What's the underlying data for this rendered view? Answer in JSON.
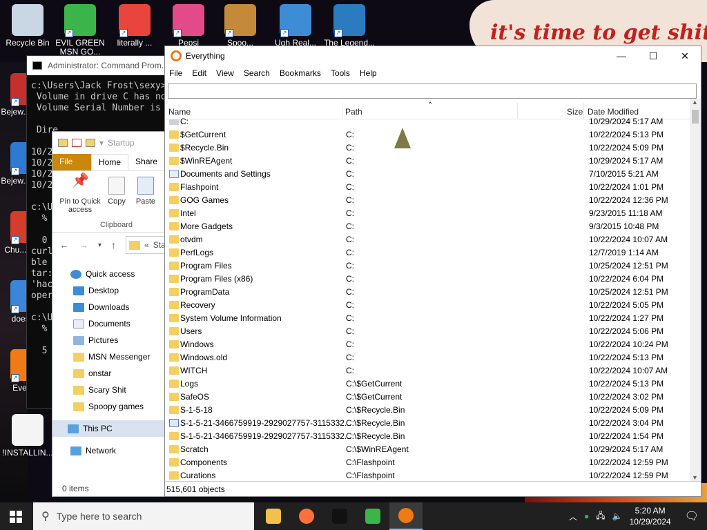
{
  "wallpaper": {
    "text": "it's time to get shit"
  },
  "desktop_icons": [
    {
      "label": "Recycle Bin",
      "icon": "recycle-bin-icon",
      "shortcut": false,
      "color": "#c9d7e5"
    },
    {
      "label": "EVIL GREEN MSN GO...",
      "icon": "msn-buddy-icon",
      "shortcut": true,
      "color": "#3bb54a"
    },
    {
      "label": "literally ...",
      "icon": "chrome-icon",
      "shortcut": true,
      "color": "#e8453c"
    },
    {
      "label": "Pepsi Nighte...",
      "icon": "pepsi-game-icon",
      "shortcut": true,
      "color": "#e24a8a"
    },
    {
      "label": "Spoo...",
      "icon": "spoopy-game-icon",
      "shortcut": true,
      "color": "#c48a39"
    },
    {
      "label": "Ugh Real...",
      "icon": "windows-shield-icon",
      "shortcut": true,
      "color": "#3f8cd6"
    },
    {
      "label": "The Legend...",
      "icon": "anime-character-icon",
      "shortcut": true,
      "color": "#2a7bbf"
    },
    {
      "label": "Bejew... Del...",
      "icon": "bejeweled-icon",
      "shortcut": true,
      "color": "#c4302b"
    },
    {
      "label": "Bejew... Del...",
      "icon": "bejeweled-blue-icon",
      "shortcut": true,
      "color": "#2e79d1"
    },
    {
      "label": "Chu... Del...",
      "icon": "chuzzle-icon",
      "shortcut": true,
      "color": "#d53c2b"
    },
    {
      "label": "doesn...",
      "icon": "water-icon",
      "shortcut": true,
      "color": "#3b86d8"
    },
    {
      "label": "Every...",
      "icon": "everything-search-icon",
      "shortcut": true,
      "color": "#f07a14"
    },
    {
      "label": "!INSTALLIN...",
      "icon": "text-document-icon",
      "shortcut": false,
      "color": "#f4f4f4"
    }
  ],
  "cmd": {
    "title": "Administrator: Command Prom...",
    "lines": [
      "c:\\Users\\Jack Frost\\sexy>",
      " Volume in drive C has no",
      " Volume Serial Number is",
      "",
      " Dire",
      "",
      "10/22",
      "10/22",
      "10/22",
      "10/22",
      "",
      "c:\\Us",
      "  % T",
      "",
      "  0",
      "curl:",
      "ble t",
      "tar:",
      "'hack",
      "opera",
      "",
      "c:\\Us",
      "  % T",
      "",
      "  5"
    ]
  },
  "explorer": {
    "title": "Startup",
    "tabs": {
      "file": "File",
      "home": "Home",
      "share": "Share"
    },
    "ribbon": {
      "pin": "Pin to Quick access",
      "copy": "Copy",
      "paste": "Paste",
      "group": "Clipboard"
    },
    "address": "Sta",
    "nav": {
      "quick_access": "Quick access",
      "items": [
        "Desktop",
        "Downloads",
        "Documents",
        "Pictures",
        "MSN Messenger",
        "onstar",
        "Scary Shit",
        "Spoopy games"
      ],
      "pinned_count": 4,
      "this_pc": "This PC",
      "network": "Network"
    },
    "status": "0 items"
  },
  "everything": {
    "title": "Everything",
    "menu": [
      "File",
      "Edit",
      "View",
      "Search",
      "Bookmarks",
      "Tools",
      "Help"
    ],
    "search_value": "",
    "columns": {
      "name": "Name",
      "path": "Path",
      "size": "Size",
      "date": "Date Modified"
    },
    "rows": [
      {
        "name": "C:",
        "path": "",
        "date": "10/29/2024 5:17 AM",
        "kind": "drive"
      },
      {
        "name": "$GetCurrent",
        "path": "C:",
        "date": "10/22/2024 5:13 PM",
        "kind": "folder"
      },
      {
        "name": "$Recycle.Bin",
        "path": "C:",
        "date": "10/22/2024 5:09 PM",
        "kind": "folder"
      },
      {
        "name": "$WinREAgent",
        "path": "C:",
        "date": "10/29/2024 5:17 AM",
        "kind": "folder"
      },
      {
        "name": "Documents and Settings",
        "path": "C:",
        "date": "7/10/2015 5:21 AM",
        "kind": "link"
      },
      {
        "name": "Flashpoint",
        "path": "C:",
        "date": "10/22/2024 1:01 PM",
        "kind": "folder"
      },
      {
        "name": "GOG Games",
        "path": "C:",
        "date": "10/22/2024 12:36 PM",
        "kind": "folder"
      },
      {
        "name": "Intel",
        "path": "C:",
        "date": "9/23/2015 11:18 AM",
        "kind": "folder"
      },
      {
        "name": "More Gadgets",
        "path": "C:",
        "date": "9/3/2015 10:48 PM",
        "kind": "folder"
      },
      {
        "name": "otvdm",
        "path": "C:",
        "date": "10/22/2024 10:07 AM",
        "kind": "folder"
      },
      {
        "name": "PerfLogs",
        "path": "C:",
        "date": "12/7/2019 1:14 AM",
        "kind": "folder"
      },
      {
        "name": "Program Files",
        "path": "C:",
        "date": "10/25/2024 12:51 PM",
        "kind": "folder"
      },
      {
        "name": "Program Files (x86)",
        "path": "C:",
        "date": "10/22/2024 6:04 PM",
        "kind": "folder"
      },
      {
        "name": "ProgramData",
        "path": "C:",
        "date": "10/25/2024 12:51 PM",
        "kind": "folder"
      },
      {
        "name": "Recovery",
        "path": "C:",
        "date": "10/22/2024 5:05 PM",
        "kind": "folder"
      },
      {
        "name": "System Volume Information",
        "path": "C:",
        "date": "10/22/2024 1:27 PM",
        "kind": "folder"
      },
      {
        "name": "Users",
        "path": "C:",
        "date": "10/22/2024 5:06 PM",
        "kind": "folder"
      },
      {
        "name": "Windows",
        "path": "C:",
        "date": "10/22/2024 10:24 PM",
        "kind": "folder"
      },
      {
        "name": "Windows.old",
        "path": "C:",
        "date": "10/22/2024 5:13 PM",
        "kind": "folder"
      },
      {
        "name": "WITCH",
        "path": "C:",
        "date": "10/22/2024 10:07 AM",
        "kind": "folder"
      },
      {
        "name": "Logs",
        "path": "C:\\$GetCurrent",
        "date": "10/22/2024 5:13 PM",
        "kind": "folder"
      },
      {
        "name": "SafeOS",
        "path": "C:\\$GetCurrent",
        "date": "10/22/2024 3:02 PM",
        "kind": "folder"
      },
      {
        "name": "S-1-5-18",
        "path": "C:\\$Recycle.Bin",
        "date": "10/22/2024 5:09 PM",
        "kind": "folder"
      },
      {
        "name": "S-1-5-21-3466759919-2929027757-3115332...",
        "path": "C:\\$Recycle.Bin",
        "date": "10/22/2024 3:04 PM",
        "kind": "file"
      },
      {
        "name": "S-1-5-21-3466759919-2929027757-3115332...",
        "path": "C:\\$Recycle.Bin",
        "date": "10/22/2024 1:54 PM",
        "kind": "folder"
      },
      {
        "name": "Scratch",
        "path": "C:\\$WinREAgent",
        "date": "10/29/2024 5:17 AM",
        "kind": "folder"
      },
      {
        "name": "Components",
        "path": "C:\\Flashpoint",
        "date": "10/22/2024 12:59 PM",
        "kind": "folder"
      },
      {
        "name": "Curations",
        "path": "C:\\Flashpoint",
        "date": "10/22/2024 12:59 PM",
        "kind": "folder"
      }
    ],
    "status": "515,601 objects"
  },
  "taskbar": {
    "search_placeholder": "Type here to search",
    "apps": [
      {
        "icon": "file-explorer-icon",
        "color": "#f2c14b",
        "active": false
      },
      {
        "icon": "firefox-icon",
        "color": "#ff7139",
        "active": false
      },
      {
        "icon": "command-prompt-icon",
        "color": "#111111",
        "active": false
      },
      {
        "icon": "msn-messenger-icon",
        "color": "#3bb54a",
        "active": false
      },
      {
        "icon": "everything-icon",
        "color": "#f07a14",
        "active": true
      }
    ],
    "time": "5:20 AM",
    "date": "10/29/2024"
  }
}
